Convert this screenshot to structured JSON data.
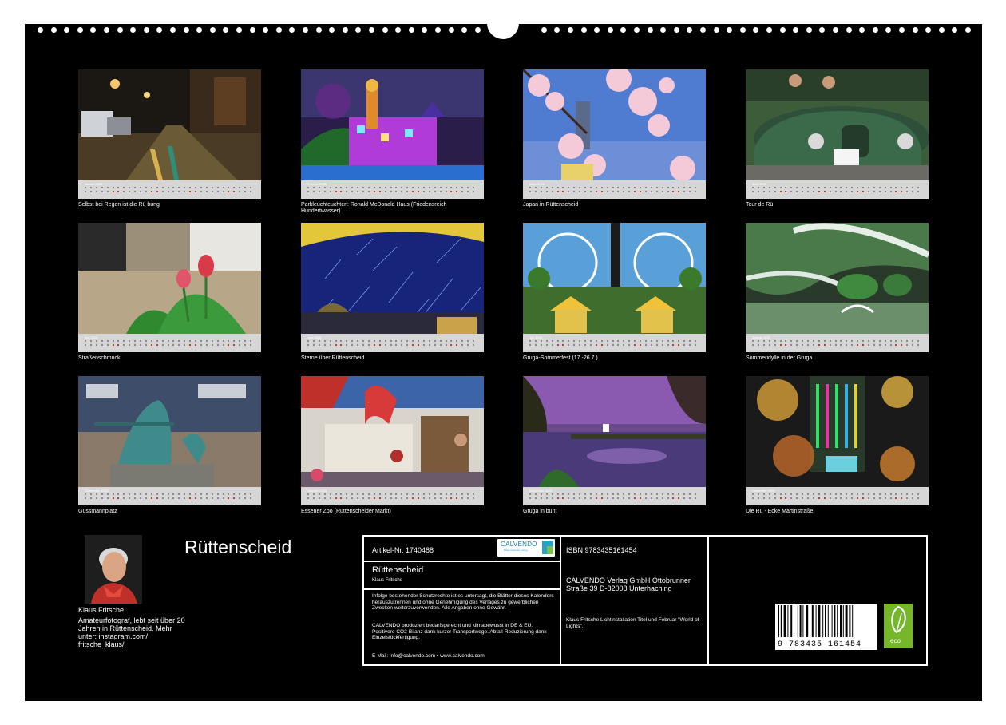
{
  "calendar": {
    "title": "Rüttenscheid",
    "author": {
      "name": "Klaus Fritsche",
      "bio": "Amateurfotograf, lebt seit über 20 Jahren in Rüttenscheid. Mehr unter: instagram.com/ fritsche_klaus/"
    },
    "months": [
      {
        "month": "Januar 2026",
        "caption": "Selbst bei Regen ist die Rü bung",
        "scene": "rainy-street-night"
      },
      {
        "month": "Februar 2026",
        "caption": "Parkleuchteuchten: Ronald McDonald Haus (Friedensreich Hundertwasser)",
        "scene": "illuminated-house"
      },
      {
        "month": "März 2026",
        "caption": "Japan in Rüttenscheid",
        "scene": "cherry-blossoms"
      },
      {
        "month": "April 2026",
        "caption": "Tour de Rü",
        "scene": "vintage-car"
      },
      {
        "month": "Mai 2026",
        "caption": "Straßenschmuck",
        "scene": "tulips"
      },
      {
        "month": "Juni 2026",
        "caption": "Sterne über Rüttenscheid",
        "scene": "star-trails"
      },
      {
        "month": "Juli 2026",
        "caption": "Gruga-Sommerfest (17.-26.7.)",
        "scene": "ferris-wheel"
      },
      {
        "month": "August 2026",
        "caption": "Sommeridylle in der Gruga",
        "scene": "park-fountain"
      },
      {
        "month": "September 2026",
        "caption": "Gussmannplatz",
        "scene": "bronze-statue"
      },
      {
        "month": "Oktober 2026",
        "caption": "Essener Zoo (Rüttenscheider Markt)",
        "scene": "market-stall"
      },
      {
        "month": "November 2026",
        "caption": "Gruga in bunt",
        "scene": "lake-dusk"
      },
      {
        "month": "Dezember 2026",
        "caption": "Die Rü - Ecke Martinstraße",
        "scene": "christmas-lights"
      }
    ]
  },
  "info": {
    "article": "Artikel-Nr. 1740488",
    "logo_text": "CALVENDO",
    "logo_sub": "Bilder Kalender verlag",
    "product_title": "Rüttenscheid",
    "product_author": "Klaus Fritsche",
    "legal_1": "Infolge bestehender Schutzrechte ist es untersagt, die Blätter dieses Kalenders herauszutrennen und ohne Genehmigung des Verlages zu gewerblichen Zwecken weiterzuverwenden. Alle Angaben ohne Gewähr.",
    "legal_2": "CALVENDO produziert bedarfsgerecht und klimabewusst in DE & EU. Positivere CO2-Bilanz dank kurzer Transportwege. Abfall-Reduzierung dank Einzelstückfertigung.",
    "contact": "E-Mail: info@calvendo.com • www.calvendo.com",
    "isbn": "ISBN 9783435161454",
    "publisher": "CALVENDO Verlag GmbH Ottobrunner Straße 39 D-82008 Unterhaching",
    "credits": "Klaus Fritsche Lichtinstallation Titel und Februar \"World of Lights\".",
    "barcode_digits": "9 783435 161454",
    "eco_label": "eco"
  },
  "colors": {
    "background": "#000000",
    "strip": "#d6d6d6",
    "weekday_dot": "#8a8a8a",
    "holiday_dot": "#c0392b",
    "eco_green": "#76b72a",
    "calvendo_blue": "#0a7db3"
  }
}
